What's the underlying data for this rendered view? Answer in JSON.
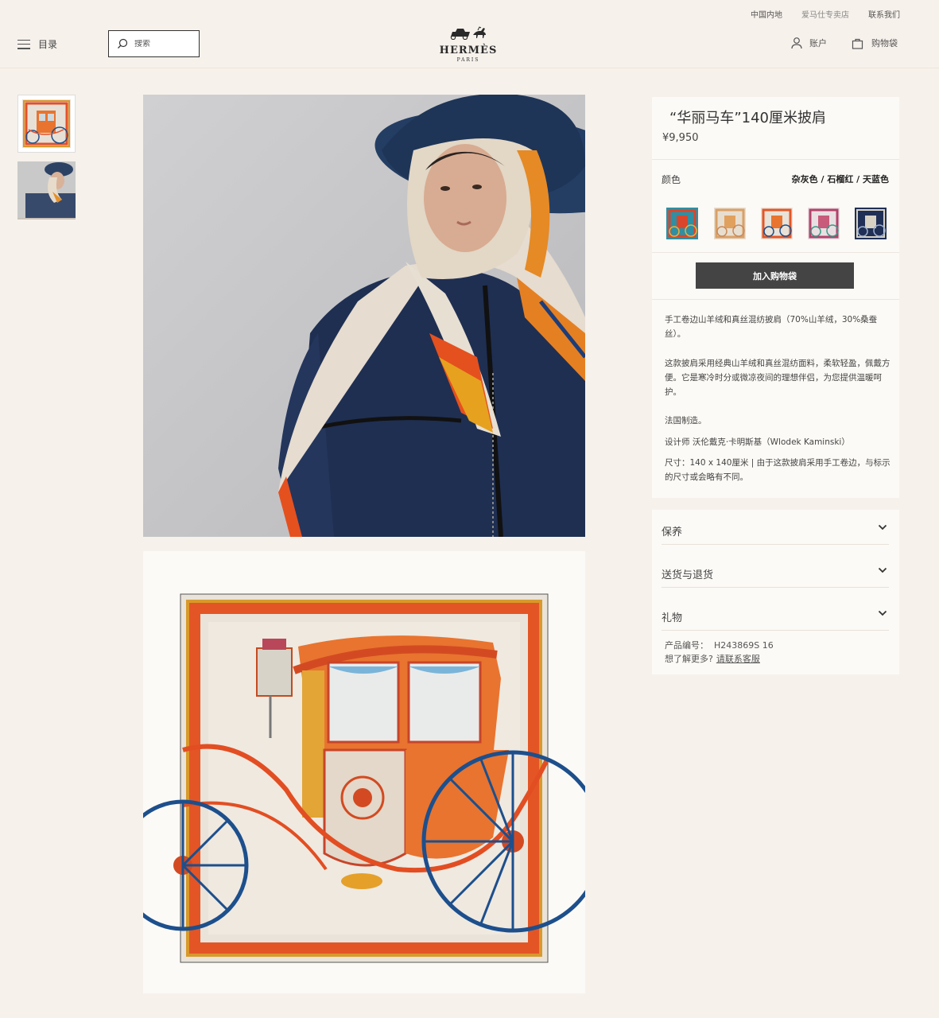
{
  "topbar": {
    "links": [
      "中国内地",
      "爱马仕专卖店",
      "联系我们"
    ]
  },
  "header": {
    "menu_label": "目录",
    "search_placeholder": "搜索",
    "logo_brand": "HERMÈS",
    "logo_city": "PARIS",
    "account_label": "账户",
    "cart_label": "购物袋"
  },
  "product": {
    "title": "“华丽马车”140厘米披肩",
    "price": "¥9,950",
    "color_label": "颜色",
    "color_value": "杂灰色 / 石榴红 / 天蓝色",
    "add_to_bag": "加入购物袋",
    "desc1": "手工卷边山羊绒和真丝混纺披肩（70%山羊绒，30%桑蚕丝）。",
    "desc2": "这款披肩采用经典山羊绒和真丝混纺面料，柔软轻盈，佩戴方便。它是寒冷时分或微凉夜间的理想伴侣，为您提供温暖呵护。",
    "desc3": "法国制造。",
    "desc4": "设计师 沃伦戴克·卡明斯基（Wlodek Kaminski）",
    "desc5": "尺寸：140 x 140厘米 | 由于这款披肩采用手工卷边，与标示的尺寸或会略有不同。"
  },
  "accordion": [
    "保养",
    "送货与退货",
    "礼物"
  ],
  "meta": {
    "sku_label": "产品编号：",
    "sku_value": "H243869S 16",
    "more_label": "想了解更多?",
    "contact_link": "请联系客服"
  },
  "colors": {
    "accent": "#444444",
    "background": "#f6f1eb",
    "panel": "#fcfaf6"
  },
  "icons": [
    "menu-icon",
    "search-icon",
    "hermes-carriage-logo",
    "user-icon",
    "bag-icon",
    "chevron-down-icon"
  ]
}
